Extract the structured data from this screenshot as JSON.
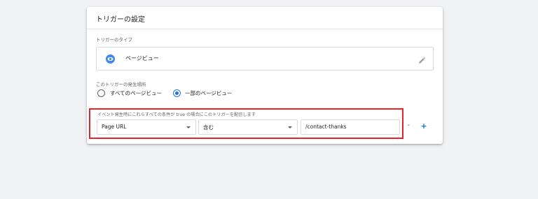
{
  "card": {
    "title": "トリガーの設定"
  },
  "trigger_type": {
    "section_label": "トリガーのタイプ",
    "value": "ページビュー",
    "icon": "eye-icon",
    "edit_icon": "pencil-icon"
  },
  "fire_on": {
    "section_label": "このトリガーの発生場所",
    "options": [
      {
        "label": "すべてのページビュー",
        "checked": false
      },
      {
        "label": "一部のページビュー",
        "checked": true
      }
    ]
  },
  "conditions": {
    "section_label": "イベント発生時にこれらすべての条件が true の場合にこのトリガーを配信します",
    "variable": "Page URL",
    "operator": "含む",
    "value": "/contact-thanks",
    "remove_label": "-",
    "add_label": "+"
  },
  "colors": {
    "accent": "#1a73e8",
    "highlight_border": "#e8232a",
    "page_bg": "#f1f2f4"
  }
}
